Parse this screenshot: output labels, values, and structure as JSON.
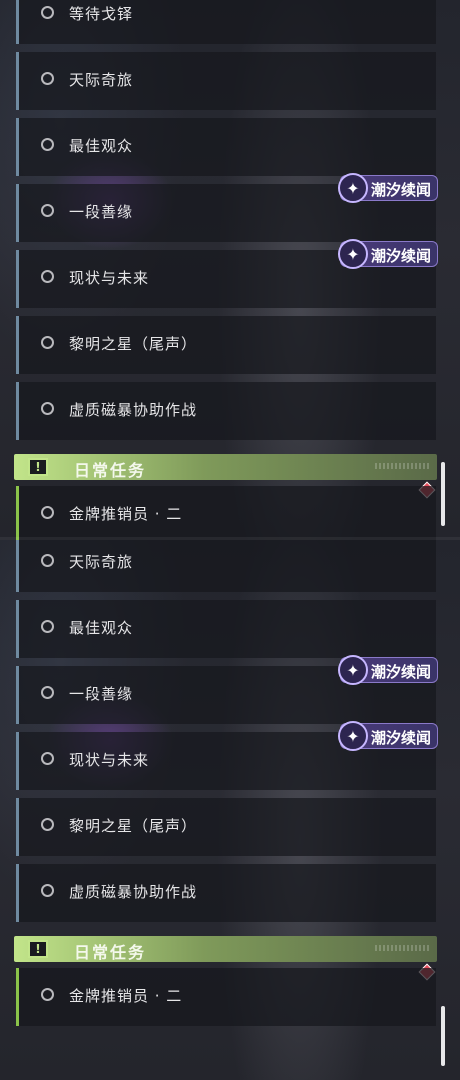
{
  "top_list": {
    "quests": [
      {
        "label": "等待戈铎"
      },
      {
        "label": "天际奇旅"
      },
      {
        "label": "最佳观众"
      },
      {
        "label": "一段善缘"
      },
      {
        "label": "现状与未来"
      },
      {
        "label": "黎明之星（尾声）"
      },
      {
        "label": "虚质磁暴协助作战"
      }
    ],
    "tags": [
      {
        "label": "潮汐续闻"
      },
      {
        "label": "潮汐续闻"
      }
    ],
    "daily_header": {
      "title": "日常任务"
    },
    "daily_quests": [
      {
        "label": "金牌推销员 · 二"
      }
    ]
  },
  "bottom_list": {
    "quests": [
      {
        "label": "天际奇旅"
      },
      {
        "label": "最佳观众"
      },
      {
        "label": "一段善缘"
      },
      {
        "label": "现状与未来"
      },
      {
        "label": "黎明之星（尾声）"
      },
      {
        "label": "虚质磁暴协助作战"
      }
    ],
    "tags": [
      {
        "label": "潮汐续闻"
      },
      {
        "label": "潮汐续闻"
      }
    ],
    "daily_header": {
      "title": "日常任务"
    },
    "daily_quests": [
      {
        "label": "金牌推销员 · 二"
      }
    ]
  },
  "icons": {
    "tag_icon": "sparkle-emblem-icon",
    "section_icon": "exclamation-box-icon",
    "status_icon": "red-diamond-icon"
  },
  "colors": {
    "daily_accent": "#c2e58a",
    "tag_bg": "#4a3a7a",
    "status_red": "#e24b5a"
  }
}
